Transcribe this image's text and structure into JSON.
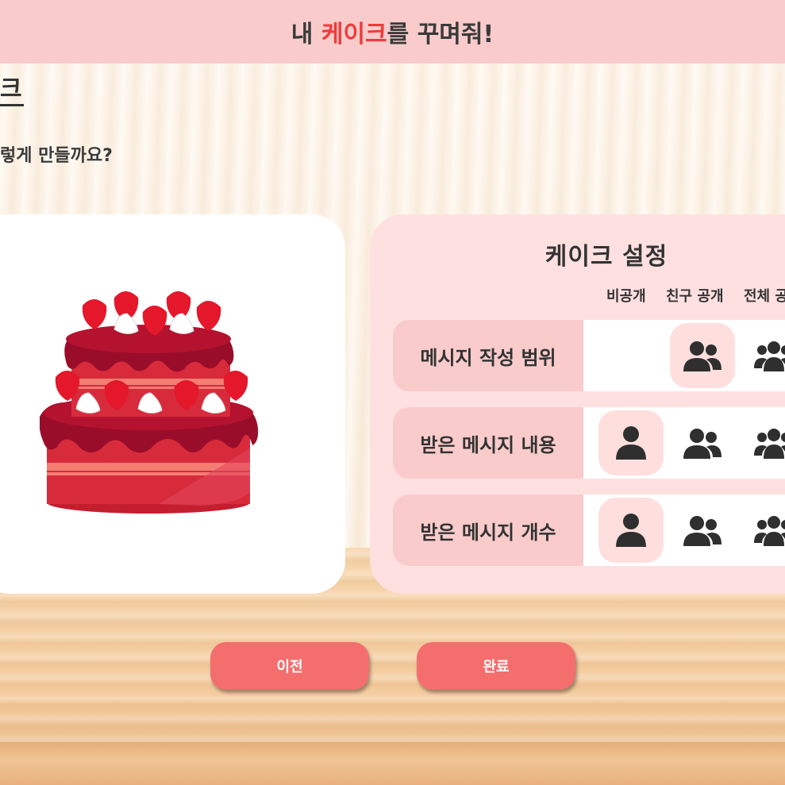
{
  "header": {
    "title_prefix": "내 ",
    "title_accent": "케이크",
    "title_suffix": "를 꾸며줘!"
  },
  "page": {
    "title": "크",
    "subtitle": "렇게 만들까요?"
  },
  "settings": {
    "title": "케이크 설정",
    "columns": [
      "비공개",
      "친구 공개",
      "전체 공"
    ],
    "rows": [
      {
        "label": "메시지 작성 범위",
        "selected": "친구 공개"
      },
      {
        "label": "받은 메시지 내용",
        "selected": "비공개"
      },
      {
        "label": "받은 메시지 개수",
        "selected": "비공개"
      }
    ]
  },
  "buttons": {
    "prev_label": "이전",
    "done_label": "완료"
  },
  "icons": {
    "private": "single-user-icon",
    "friends": "two-users-icon",
    "public": "three-users-icon"
  },
  "colors": {
    "header_bg": "#f9cbcb",
    "accent": "#ef3b3b",
    "button": "#f46e6e",
    "panel_bg": "#ffe0e0",
    "selected_bg": "#ffdede"
  }
}
